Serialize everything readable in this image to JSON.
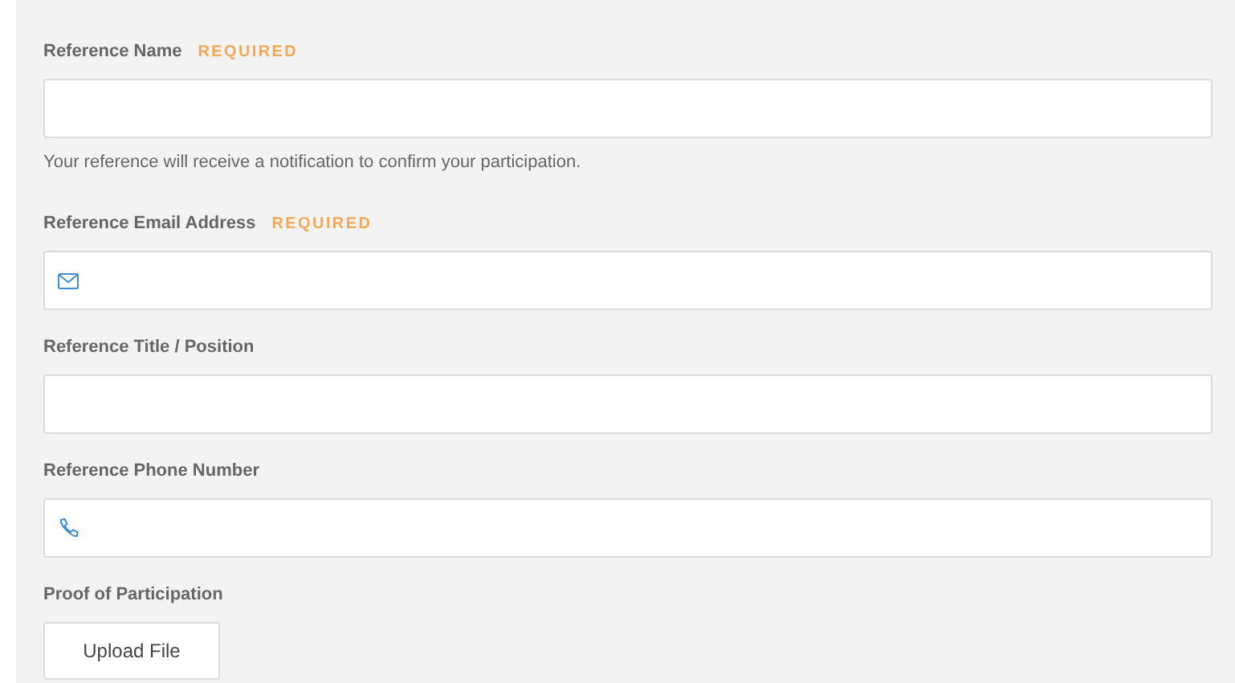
{
  "fields": [
    {
      "kind": "text",
      "label": "Reference Name",
      "required_tag": "REQUIRED",
      "help": "Your reference will receive a notification to confirm your participation."
    },
    {
      "kind": "email",
      "label": "Reference Email Address",
      "required_tag": "REQUIRED"
    },
    {
      "kind": "text",
      "label": "Reference Title / Position"
    },
    {
      "kind": "phone",
      "label": "Reference Phone Number"
    },
    {
      "kind": "file",
      "label": "Proof of Participation",
      "button": "Upload File"
    }
  ]
}
